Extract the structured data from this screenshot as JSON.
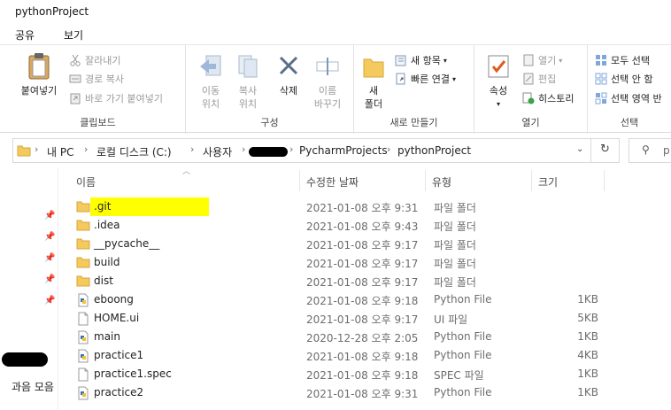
{
  "window": {
    "title": "pythonProject"
  },
  "menu_tabs": [
    "공유",
    "보기"
  ],
  "ribbon": {
    "clipboard": {
      "label": "클립보드",
      "paste": "붙여넣기",
      "cut": "잘라내기",
      "copy_path": "경로 복사",
      "paste_shortcut": "바로 가기 붙여넣기"
    },
    "organize": {
      "label": "구성",
      "move_to": [
        "이동",
        "위치"
      ],
      "copy_to": [
        "복사",
        "위치"
      ],
      "delete": "삭제",
      "rename": [
        "이름",
        "바꾸기"
      ]
    },
    "new": {
      "label": "새로 만들기",
      "new_folder": [
        "새",
        "폴더"
      ],
      "new_item": "새 항목",
      "easy_access": "빠른 연결"
    },
    "open": {
      "label": "열기",
      "properties": "속성",
      "open": "열기",
      "edit": "편집",
      "history": "히스토리"
    },
    "select": {
      "label": "선택",
      "select_all": "모두 선택",
      "select_none": "선택 안 함",
      "invert": "선택 영역 반"
    }
  },
  "address": {
    "crumbs": [
      "내 PC",
      "로컬 디스크 (C:)",
      "사용자",
      "PycharmProjects",
      "pythonProject"
    ],
    "search_placeholder": "p"
  },
  "columns": {
    "name": "이름",
    "modified": "수정한 날짜",
    "type": "유형",
    "size": "크기"
  },
  "files": [
    {
      "name": ".git",
      "modified": "2021-01-08 오후 9:31",
      "type": "파일 폴더",
      "size": "",
      "icon": "folder-icon",
      "highlight": true
    },
    {
      "name": ".idea",
      "modified": "2021-01-08 오후 9:43",
      "type": "파일 폴더",
      "size": "",
      "icon": "folder-icon"
    },
    {
      "name": "__pycache__",
      "modified": "2021-01-08 오후 9:17",
      "type": "파일 폴더",
      "size": "",
      "icon": "folder-icon"
    },
    {
      "name": "build",
      "modified": "2021-01-08 오후 9:17",
      "type": "파일 폴더",
      "size": "",
      "icon": "folder-icon"
    },
    {
      "name": "dist",
      "modified": "2021-01-08 오후 9:17",
      "type": "파일 폴더",
      "size": "",
      "icon": "folder-icon"
    },
    {
      "name": "eboong",
      "modified": "2021-01-08 오후 9:18",
      "type": "Python File",
      "size": "1KB",
      "icon": "python-file-icon"
    },
    {
      "name": "HOME.ui",
      "modified": "2021-01-08 오후 9:17",
      "type": "UI 파일",
      "size": "5KB",
      "icon": "file-icon"
    },
    {
      "name": "main",
      "modified": "2020-12-28 오후 2:05",
      "type": "Python File",
      "size": "1KB",
      "icon": "python-file-icon"
    },
    {
      "name": "practice1",
      "modified": "2021-01-08 오후 9:18",
      "type": "Python File",
      "size": "4KB",
      "icon": "python-file-icon"
    },
    {
      "name": "practice1.spec",
      "modified": "2021-01-08 오후 9:18",
      "type": "SPEC 파일",
      "size": "1KB",
      "icon": "file-icon"
    },
    {
      "name": "practice2",
      "modified": "2021-01-08 오후 9:31",
      "type": "Python File",
      "size": "1KB",
      "icon": "python-file-icon"
    }
  ],
  "leftnav": {
    "music_label": "과음 모음"
  },
  "colors": {
    "folder": "#f4c95d",
    "highlight": "#ffff00",
    "accent": "#0078d7"
  }
}
